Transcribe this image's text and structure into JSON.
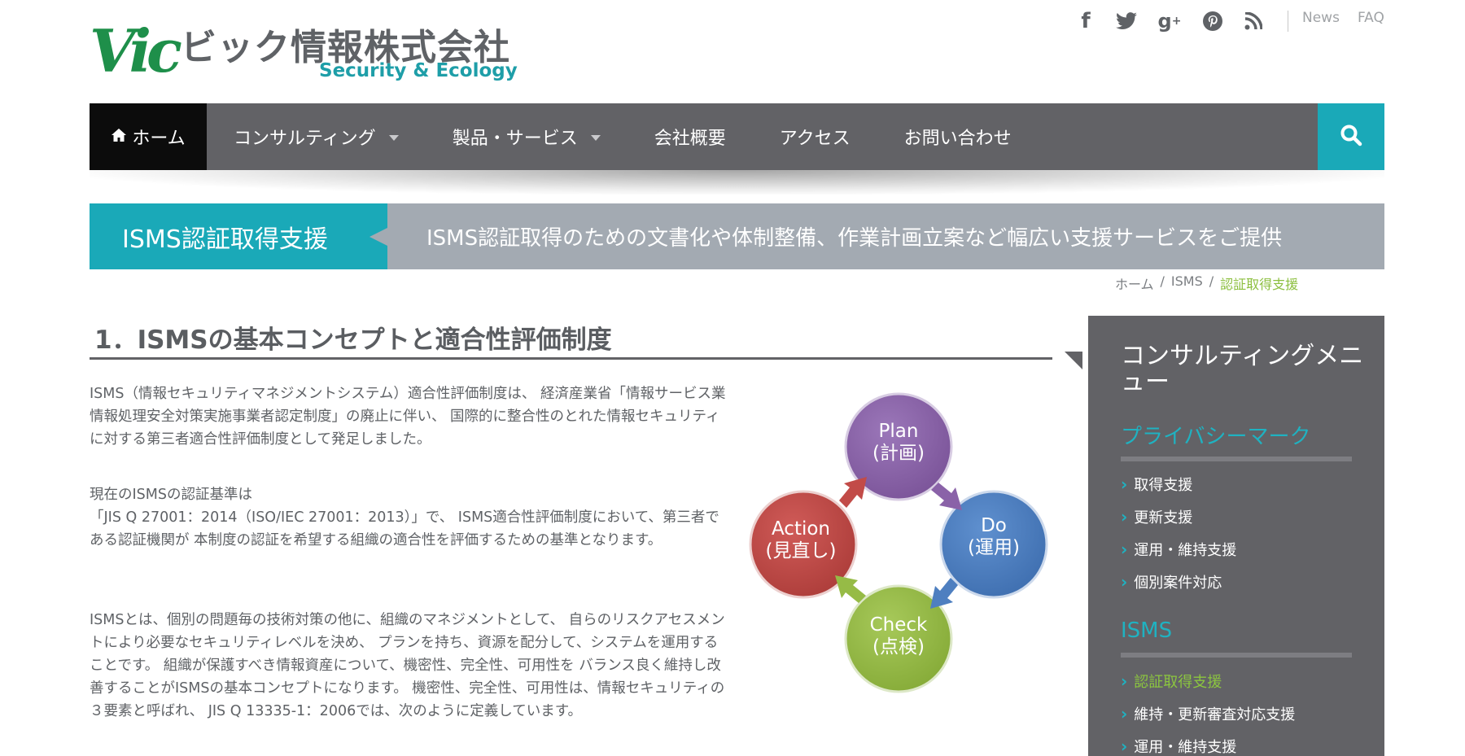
{
  "header": {
    "logo_mark": "Vic",
    "company": "ビック情報株式会社",
    "tagline": "Security & Ecology",
    "social_icons": [
      "facebook-icon",
      "twitter-icon",
      "google-plus-icon",
      "pinterest-icon",
      "rss-icon"
    ],
    "links": [
      "News",
      "FAQ"
    ]
  },
  "nav": {
    "home": "ホーム",
    "items": [
      {
        "label": "コンサルティング",
        "dropdown": true
      },
      {
        "label": "製品・サービス",
        "dropdown": true
      },
      {
        "label": "会社概要",
        "dropdown": false
      },
      {
        "label": "アクセス",
        "dropdown": false
      },
      {
        "label": "お問い合わせ",
        "dropdown": false
      }
    ]
  },
  "banner": {
    "title": "ISMS認証取得支援",
    "description": "ISMS認証取得のための文書化や体制整備、作業計画立案など幅広い支援サービスをご提供"
  },
  "breadcrumb": [
    "ホーム",
    "ISMS",
    "認証取得支援"
  ],
  "main": {
    "section_title": "1．ISMSの基本コンセプトと適合性評価制度",
    "paragraphs": [
      "ISMS（情報セキュリティマネジメントシステム）適合性評価制度は、 経済産業省「情報サービス業情報処理安全対策実施事業者認定制度」の廃止に伴い、 国際的に整合性のとれた情報セキュリティに対する第三者適合性評価制度として発足しました。",
      "現在のISMSの認証基準は",
      "「JIS Q 27001：2014（ISO/IEC 27001：2013）」で、 ISMS適合性評価制度において、第三者である認証機関が 本制度の認証を希望する組織の適合性を評価するための基準となります。",
      "ISMSとは、個別の問題毎の技術対策の他に、組織のマネジメントとして、 自らのリスクアセスメントにより必要なセキュリティレベルを決め、 プランを持ち、資源を配分して、システムを運用することです。 組織が保護すべき情報資産について、機密性、完全性、可用性を バランス良く維持し改善することがISMSの基本コンセプトになります。 機密性、完全性、可用性は、情報セキュリティの３要素と呼ばれ、 JIS Q 13335-1：2006では、次のように定義しています。"
    ],
    "pdca": {
      "plan": {
        "en": "Plan",
        "ja": "(計画)",
        "color": "#8a62a8"
      },
      "do": {
        "en": "Do",
        "ja": "(運用)",
        "color": "#4e7fc0"
      },
      "check": {
        "en": "Check",
        "ja": "(点検)",
        "color": "#96bb46"
      },
      "action": {
        "en": "Action",
        "ja": "(見直し)",
        "color": "#c24b48"
      }
    }
  },
  "sidebar": {
    "title": "コンサルティングメニュー",
    "groups": [
      {
        "heading": "プライバシーマーク",
        "items": [
          "取得支援",
          "更新支援",
          "運用・維持支援",
          "個別案件対応"
        ]
      },
      {
        "heading": "ISMS",
        "items": [
          "認証取得支援",
          "維持・更新審査対応支援",
          "運用・維持支援"
        ]
      }
    ],
    "active_item": "認証取得支援"
  },
  "colors": {
    "nav_bg": "#626266",
    "accent_teal": "#1aa9b8",
    "active_green": "#8cc63f",
    "banner_gray": "#a3aab2"
  }
}
